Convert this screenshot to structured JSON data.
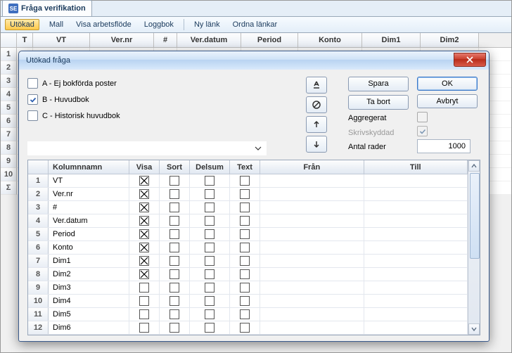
{
  "main": {
    "tab_title": "Fråga verifikation",
    "toolbar": [
      "Utökad",
      "Mall",
      "Visa arbetsflöde",
      "Loggbok",
      "Ny länk",
      "Ordna länkar"
    ],
    "toolbar_selected_index": 0,
    "grid_headers": [
      "T",
      "VT",
      "Ver.nr",
      "#",
      "Ver.datum",
      "Period",
      "Konto",
      "Dim1",
      "Dim2"
    ],
    "grid_header_widths": [
      22,
      80,
      90,
      32,
      90,
      80,
      90,
      82,
      82
    ],
    "row_numbers": [
      "1",
      "2",
      "3",
      "4",
      "5",
      "6",
      "7",
      "8",
      "9",
      "10",
      "Σ"
    ]
  },
  "dialog": {
    "title": "Utökad fråga",
    "checkboxes": [
      {
        "label": "A - Ej bokförda poster",
        "checked": false
      },
      {
        "label": "B - Huvudbok",
        "checked": true
      },
      {
        "label": "C - Historisk huvudbok",
        "checked": false
      }
    ],
    "icon_buttons": [
      "reset-icon",
      "clear-icon",
      "up-icon",
      "down-icon"
    ],
    "buttons": {
      "spara": "Spara",
      "ta_bort": "Ta bort",
      "ok": "OK",
      "avbryt": "Avbryt"
    },
    "label_aggregerat": "Aggregerat",
    "aggregerat_checked": false,
    "label_skrivskyddad": "Skrivskyddad",
    "skrivskyddad_checked": true,
    "label_antal_rader": "Antal rader",
    "antal_rader_value": "1000",
    "combo_value": "",
    "columns_table": {
      "headers": [
        "",
        "Kolumnnamn",
        "Visa",
        "Sort",
        "Delsum",
        "Text",
        "Från",
        "Till"
      ],
      "rows": [
        {
          "idx": 1,
          "name": "VT",
          "visa": true,
          "sort": false,
          "delsum": false,
          "text": false
        },
        {
          "idx": 2,
          "name": "Ver.nr",
          "visa": true,
          "sort": false,
          "delsum": false,
          "text": false
        },
        {
          "idx": 3,
          "name": "#",
          "visa": true,
          "sort": false,
          "delsum": false,
          "text": false
        },
        {
          "idx": 4,
          "name": "Ver.datum",
          "visa": true,
          "sort": false,
          "delsum": false,
          "text": false
        },
        {
          "idx": 5,
          "name": "Period",
          "visa": true,
          "sort": false,
          "delsum": false,
          "text": false
        },
        {
          "idx": 6,
          "name": "Konto",
          "visa": true,
          "sort": false,
          "delsum": false,
          "text": false
        },
        {
          "idx": 7,
          "name": "Dim1",
          "visa": true,
          "sort": false,
          "delsum": false,
          "text": false
        },
        {
          "idx": 8,
          "name": "Dim2",
          "visa": true,
          "sort": false,
          "delsum": false,
          "text": false
        },
        {
          "idx": 9,
          "name": "Dim3",
          "visa": false,
          "sort": false,
          "delsum": false,
          "text": false
        },
        {
          "idx": 10,
          "name": "Dim4",
          "visa": false,
          "sort": false,
          "delsum": false,
          "text": false
        },
        {
          "idx": 11,
          "name": "Dim5",
          "visa": false,
          "sort": false,
          "delsum": false,
          "text": false
        },
        {
          "idx": 12,
          "name": "Dim6",
          "visa": false,
          "sort": false,
          "delsum": false,
          "text": false
        }
      ]
    }
  }
}
